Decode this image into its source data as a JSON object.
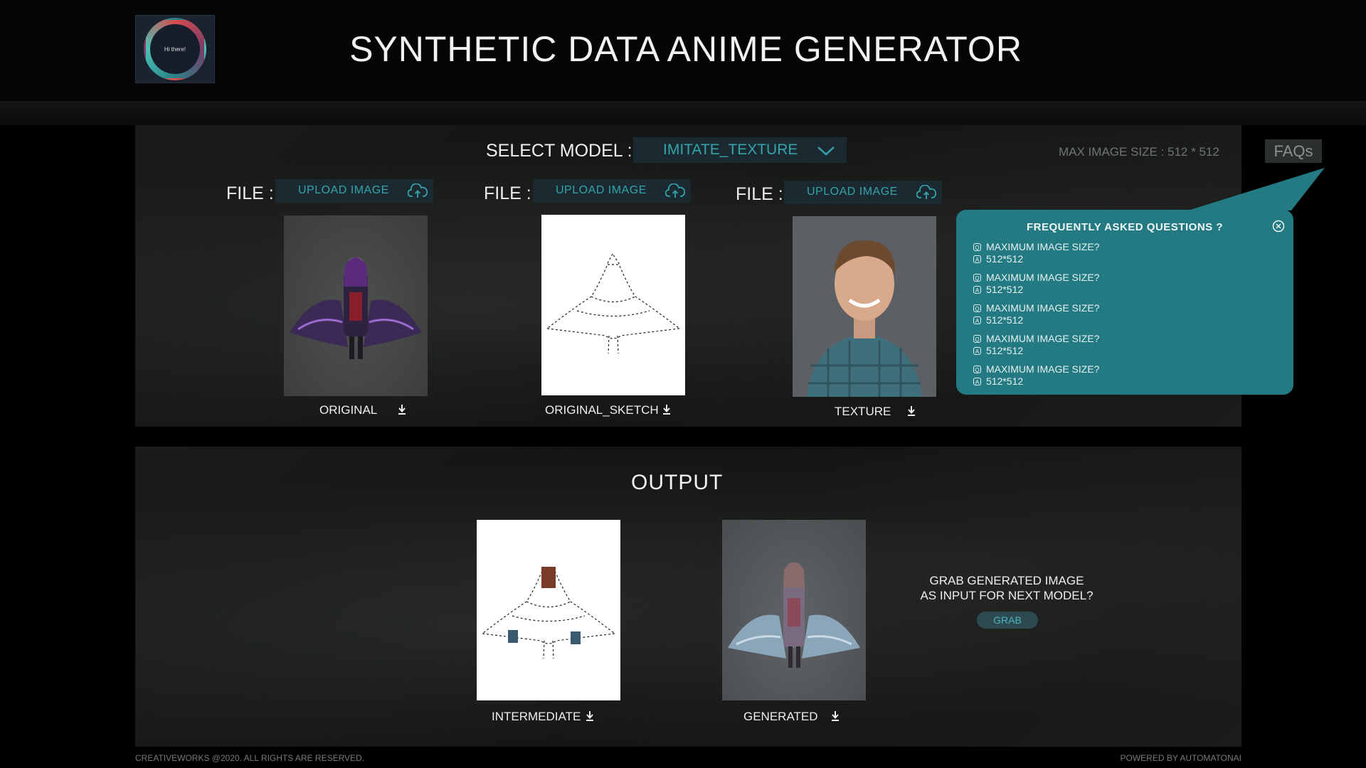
{
  "header": {
    "logo_text": "Hi there!",
    "title": "SYNTHETIC DATA ANIME GENERATOR"
  },
  "controls": {
    "select_model_label": "SELECT MODEL :",
    "selected_model": "IMITATE_TEXTURE",
    "max_image_size": "MAX IMAGE SIZE : 512 * 512",
    "faq_button": "FAQs"
  },
  "inputs": [
    {
      "file_label": "FILE :",
      "upload_label": "UPLOAD IMAGE",
      "caption": "ORIGINAL"
    },
    {
      "file_label": "FILE :",
      "upload_label": "UPLOAD IMAGE",
      "caption": "ORIGINAL_SKETCH"
    },
    {
      "file_label": "FILE :",
      "upload_label": "UPLOAD IMAGE",
      "caption": "TEXTURE"
    }
  ],
  "faq": {
    "title": "FREQUENTLY ASKED QUESTIONS ?",
    "items": [
      {
        "q": "MAXIMUM IMAGE SIZE?",
        "a": "512*512"
      },
      {
        "q": "MAXIMUM IMAGE SIZE?",
        "a": "512*512"
      },
      {
        "q": "MAXIMUM IMAGE SIZE?",
        "a": "512*512"
      },
      {
        "q": "MAXIMUM IMAGE SIZE?",
        "a": "512*512"
      },
      {
        "q": "MAXIMUM IMAGE SIZE?",
        "a": "512*512"
      }
    ]
  },
  "output": {
    "title": "OUTPUT",
    "intermediate_caption": "INTERMEDIATE",
    "generated_caption": "GENERATED",
    "grab_prompt_line1": "GRAB GENERATED IMAGE",
    "grab_prompt_line2": "AS INPUT FOR NEXT MODEL?",
    "grab_button": "GRAB"
  },
  "footer": {
    "left": "CREATIVEWORKS @2020. ALL RIGHTS ARE RESERVED.",
    "right": "POWERED BY AUTOMATONAI"
  },
  "colors": {
    "accent": "#36a3ac",
    "faq_panel": "#237a82",
    "background": "#000000"
  },
  "icons": [
    "cloud-upload-icon",
    "download-icon",
    "chevron-down-icon",
    "close-icon"
  ]
}
